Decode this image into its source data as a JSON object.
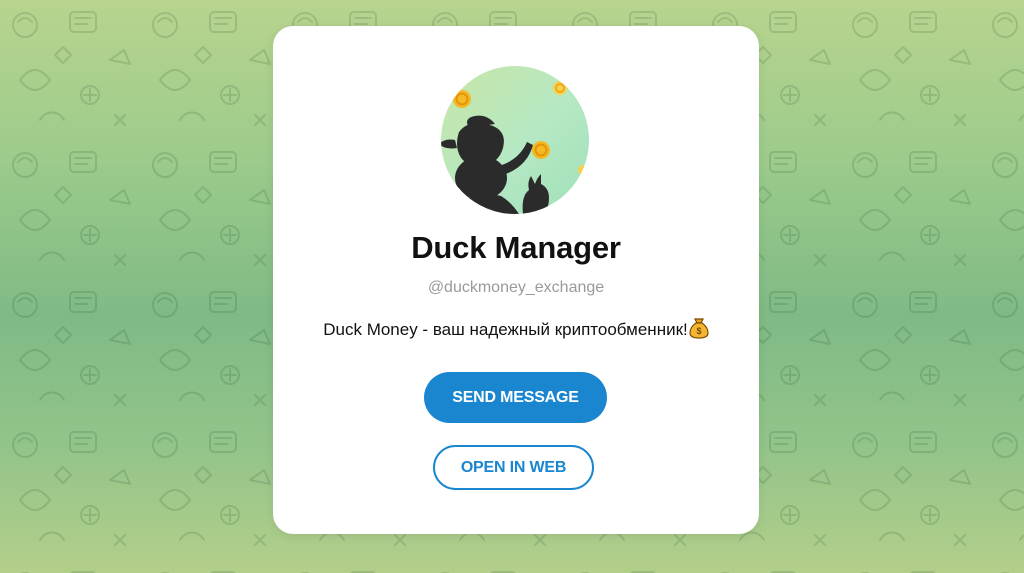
{
  "profile": {
    "name": "Duck Manager",
    "username": "@duckmoney_exchange",
    "bio": "Duck Money - ваш надежный криптообменник!",
    "bio_emoji_icon": "money-bag-icon",
    "avatar_icon": "duck-juggling-coins-avatar"
  },
  "actions": {
    "send_message_label": "SEND MESSAGE",
    "open_in_web_label": "OPEN IN WEB"
  },
  "colors": {
    "accent": "#1a86cf",
    "background_top": "#b8d48e",
    "background_mid": "#7fba85",
    "card": "#ffffff",
    "username": "#9a9a9a"
  }
}
